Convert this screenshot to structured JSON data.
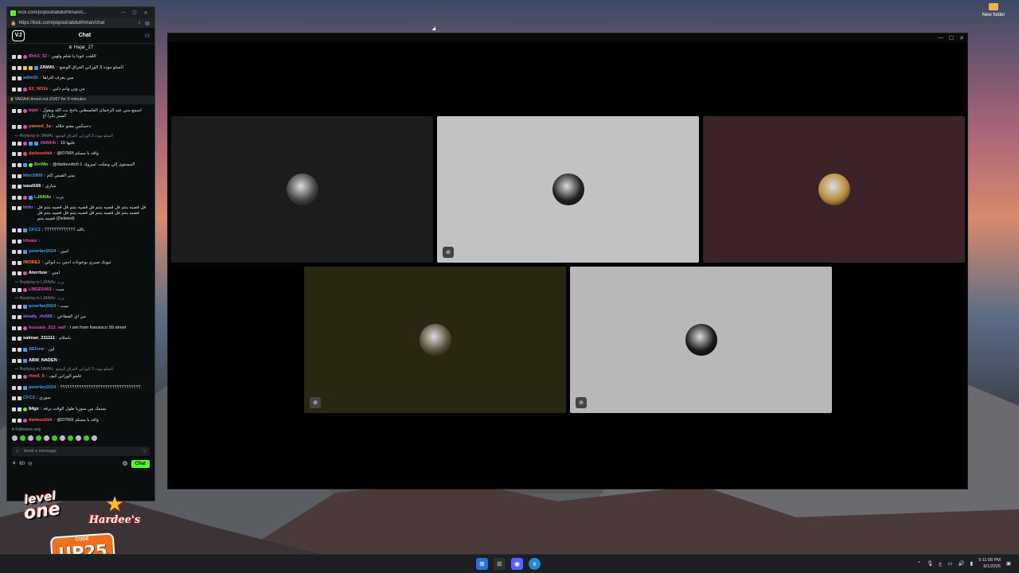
{
  "desktop": {
    "folder_label": "New folder"
  },
  "browser": {
    "tab_title": "kick.com/popout/abdulrhman/c...",
    "url": "https://kick.com/popout/abdulrhman/chat",
    "min": "—",
    "max": "☐",
    "close": "✕"
  },
  "chat": {
    "logo": "VJ",
    "title": "Chat",
    "pinned_user": "Hajar_27",
    "messages": [
      {
        "user": "f0rb1_32",
        "color": "#e449ad",
        "text": "اللعب عودا يا شلم ولهين",
        "badges": [
          "w",
          "w",
          "p"
        ]
      },
      {
        "user": "2AMAL",
        "color": "#ffffff",
        "text": "السلو مودد 3 الوزاني العراق الوضع",
        "badges": [
          "w",
          "w",
          "y",
          "y",
          "b"
        ]
      },
      {
        "user": "adim3c",
        "color": "#3aa0e8",
        "text": "مين يعرف اقرأها",
        "badges": [
          "w",
          "w"
        ]
      },
      {
        "user": "E2_NO2z",
        "color": "#ff5a5a",
        "text": "من وين وانم دلني",
        "badges": [
          "w",
          "w",
          "p"
        ]
      },
      {
        "sys": "YARA4I timed out ZU67 for 5 minutes"
      },
      {
        "user": "tnjat",
        "color": "#e449ad",
        "text": "اسمع مني عبد الرحمان الفلسطني ياحج بت الله ويقول كسبر بكرا اخ",
        "badges": [
          "w",
          "w",
          "p"
        ],
        "multi": true
      },
      {
        "user": "yazeed_1a",
        "color": "#ff7a3c",
        "text": "دحمكمن معتو خلاله",
        "badges": [
          "w",
          "w",
          "p"
        ]
      },
      {
        "reply": "Replying to 2AMAL: السلو مودد 3 الوزاني العراق الوضع"
      },
      {
        "user": "YARA4i",
        "color": "#e449ad",
        "text": "عليها 10",
        "badges": [
          "w",
          "w",
          "p",
          "b",
          "b"
        ]
      },
      {
        "user": "dadouvitsh",
        "color": "#ff5a5a",
        "text": "@D7MX واقد يا مسلم",
        "badges": [
          "w",
          "w",
          "p"
        ]
      },
      {
        "user": "BotMo",
        "color": "#53fc18",
        "text": "@dadouvitsh 1 المستوى إلى وصلت !مبروك",
        "badges": [
          "w",
          "w",
          "b",
          "g"
        ]
      },
      {
        "user": "Mori1909",
        "color": "#3aa0e8",
        "text": "متى القبس كام",
        "badges": [
          "w",
          "w"
        ]
      },
      {
        "user": "saud166",
        "color": "#ffffff",
        "text": "ساري",
        "badges": [
          "w",
          "w"
        ]
      },
      {
        "user": "LJANAz",
        "color": "#53fc18",
        "text": "يرب",
        "badges": [
          "w",
          "w",
          "p",
          "b"
        ]
      },
      {
        "user": "hhfu",
        "color": "#9a6cff",
        "text": "فل قصيه بنتم فل قصيه بنتم فل قصيه بنتم فل قصيه بنتم فل قصيه بنتم فل قصيه بنتم فل قصيه بنتم فل قصيه بنتم فل قصيه بنتم (Deleted)",
        "badges": [
          "w",
          "w"
        ],
        "multi": true
      },
      {
        "user": "CFC3",
        "color": "#3aa0e8",
        "text": "بالله ؟؟؟؟؟؟؟؟؟؟؟؟؟",
        "badges": [
          "w",
          "w",
          "b"
        ]
      },
      {
        "user": "hfowiz",
        "color": "#e449ad",
        "text": "",
        "badges": [
          "w",
          "w"
        ]
      },
      {
        "user": "powrfan2024",
        "color": "#3aa0e8",
        "text": "امين",
        "badges": [
          "w",
          "w",
          "b"
        ]
      },
      {
        "user": "iMORE2",
        "color": "#ff7a3c",
        "text": "ثيونك صبري يوجونات ادمن ب ابوكي",
        "badges": [
          "w",
          "w"
        ]
      },
      {
        "user": "Aterrtuw",
        "color": "#ffffff",
        "text": "امين",
        "badges": [
          "w",
          "w",
          "p"
        ]
      },
      {
        "reply": "Replying to LJANAz: يرب"
      },
      {
        "user": "LMEES453",
        "color": "#e449ad",
        "text": "ميت",
        "badges": [
          "w",
          "w",
          "p"
        ]
      },
      {
        "reply": "Replying to LJANAz: يرب"
      },
      {
        "user": "powrfan2024",
        "color": "#3aa0e8",
        "text": "ميت",
        "badges": [
          "w",
          "w",
          "b"
        ]
      },
      {
        "user": "alsady_rtx505",
        "color": "#9a6cff",
        "text": "من اي القطاعن",
        "badges": [
          "w",
          "w"
        ]
      },
      {
        "user": "hussain_313_saif",
        "color": "#e449ad",
        "text": "i am from fransisco 99 street",
        "badges": [
          "w",
          "w",
          "p"
        ]
      },
      {
        "user": "salman_211111",
        "color": "#ffffff",
        "text": "باسلام",
        "badges": [
          "w",
          "w"
        ]
      },
      {
        "user": "AElorw",
        "color": "#3aa0e8",
        "text": "لين",
        "badges": [
          "w",
          "w",
          "b"
        ]
      },
      {
        "user": "ABM_NADEN",
        "color": "#ffffff",
        "text": "",
        "badges": [
          "w",
          "w",
          "b"
        ]
      },
      {
        "reply": "Replying to 2AMAL: السلو مودد 3 الوزاني العراق الوضع"
      },
      {
        "user": "rfim5_5",
        "color": "#ff5a5a",
        "text": "علمو الوراني كيف",
        "badges": [
          "w",
          "w",
          "p"
        ]
      },
      {
        "user": "powrfan2024",
        "color": "#3aa0e8",
        "text": "؟؟؟؟؟؟؟؟؟؟؟؟؟؟؟؟؟؟؟؟؟؟؟؟؟؟؟؟؟؟؟؟؟؟",
        "badges": [
          "w",
          "w",
          "b"
        ],
        "multi": true
      },
      {
        "user": "CFC3",
        "color": "#3aa0e8",
        "text": "سوري",
        "badges": [
          "w",
          "w"
        ]
      },
      {
        "user": "84gx",
        "color": "#ffffff",
        "text": "تسمك من سوريا طول الوقت يرفة",
        "badges": [
          "w",
          "w",
          "g"
        ]
      },
      {
        "user": "dadouvitsh",
        "color": "#ff5a5a",
        "text": "@D7MX واقد يا مسلم",
        "badges": [
          "w",
          "w",
          "p"
        ]
      }
    ],
    "followers_only": "Followers only",
    "input_placeholder": "Send a message",
    "points": "60",
    "send_label": "Chat"
  },
  "sponsors": {
    "level_one_top": "level",
    "level_one_bottom": "one",
    "hardees": "Hardee's",
    "promo_code_label": "CODE",
    "promo_code": "UP25"
  },
  "video": {
    "tiles": [
      {
        "bg": "#1c1c1c",
        "avatar": "#444444",
        "cam_off": false
      },
      {
        "bg": "#c2c2c2",
        "avatar": "#222222",
        "cam_off": true
      },
      {
        "bg": "#3a2226",
        "avatar": "#b88a3a",
        "cam_off": false
      },
      {
        "bg": "#2a2614",
        "avatar": "#5a5038",
        "cam_off": true
      },
      {
        "bg": "#b8b8b8",
        "avatar": "#1a1a1a",
        "cam_off": true
      }
    ]
  },
  "taskbar": {
    "time": "9:11:08 PM",
    "date": "8/1/2026",
    "lang": "ع"
  }
}
